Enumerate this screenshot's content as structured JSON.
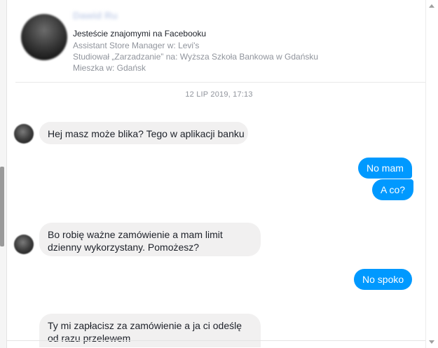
{
  "profile": {
    "name": "Dawid Ru",
    "friends_text": "Jesteście znajomymi na Facebooku",
    "info": [
      "Assistant Store Manager w: Levi's",
      "Studiował „Zarzadzanie” na: Wyższa Szkoła Bankowa w Gdańsku",
      "Mieszka w: Gdańsk"
    ]
  },
  "timestamp": "12 LIP 2019, 17:13",
  "messages": [
    {
      "sender": "them",
      "text": "Hej masz może blika? Tego w aplikacji banku"
    },
    {
      "sender": "me",
      "text": "No mam"
    },
    {
      "sender": "me",
      "text": "A co?"
    },
    {
      "sender": "them",
      "text": "Bo robię ważne zamówienie a mam limit dzienny wykorzystany. Pomożesz?"
    },
    {
      "sender": "me",
      "text": "No spoko"
    },
    {
      "sender": "them",
      "text": "Ty mi zapłacisz za zamówienie a ja ci odeślę od razu przelewem"
    }
  ],
  "colors": {
    "outgoing_bubble": "#0099ff",
    "incoming_bubble": "#f1f0f0",
    "meta_text": "#90949c"
  },
  "icons": [
    "scroll-up-icon",
    "scroll-down-icon"
  ]
}
